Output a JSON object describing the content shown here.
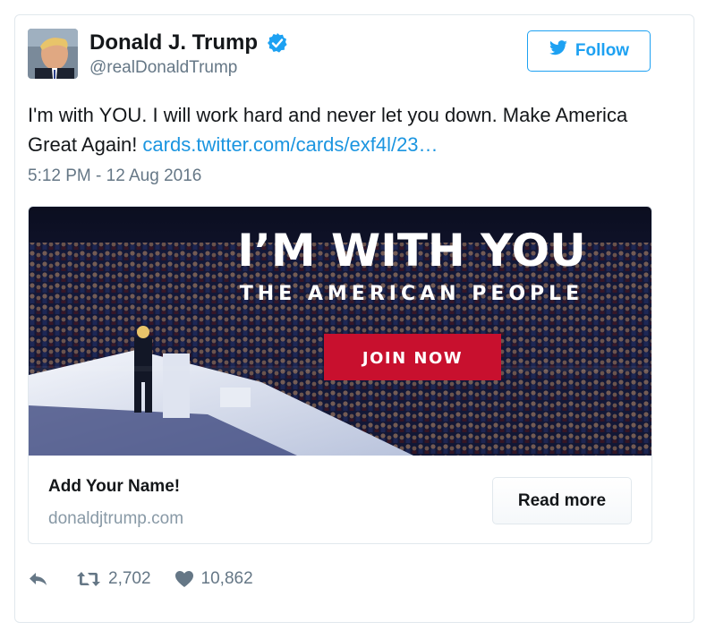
{
  "author": {
    "display_name": "Donald J. Trump",
    "handle": "@realDonaldTrump",
    "verified": true
  },
  "follow_label": "Follow",
  "tweet": {
    "text": "I'm with YOU. I will work hard and never let you down. Make America Great Again! ",
    "link_text": "cards.twitter.com/cards/exf4l/23…",
    "timestamp": "5:12 PM - 12 Aug 2016"
  },
  "card": {
    "headline": "I’M WITH YOU",
    "subheadline": "THE AMERICAN PEOPLE",
    "cta": "JOIN NOW",
    "title": "Add Your Name!",
    "domain": "donaldjtrump.com",
    "read_more": "Read more"
  },
  "actions": {
    "retweets": "2,702",
    "likes": "10,862"
  },
  "colors": {
    "twitter_blue": "#1da1f2",
    "link": "#1b95e0",
    "cta_red": "#c8102e",
    "secondary_text": "#657786"
  },
  "icons": [
    "verified-badge-icon",
    "twitter-bird-icon",
    "reply-icon",
    "retweet-icon",
    "heart-icon"
  ]
}
